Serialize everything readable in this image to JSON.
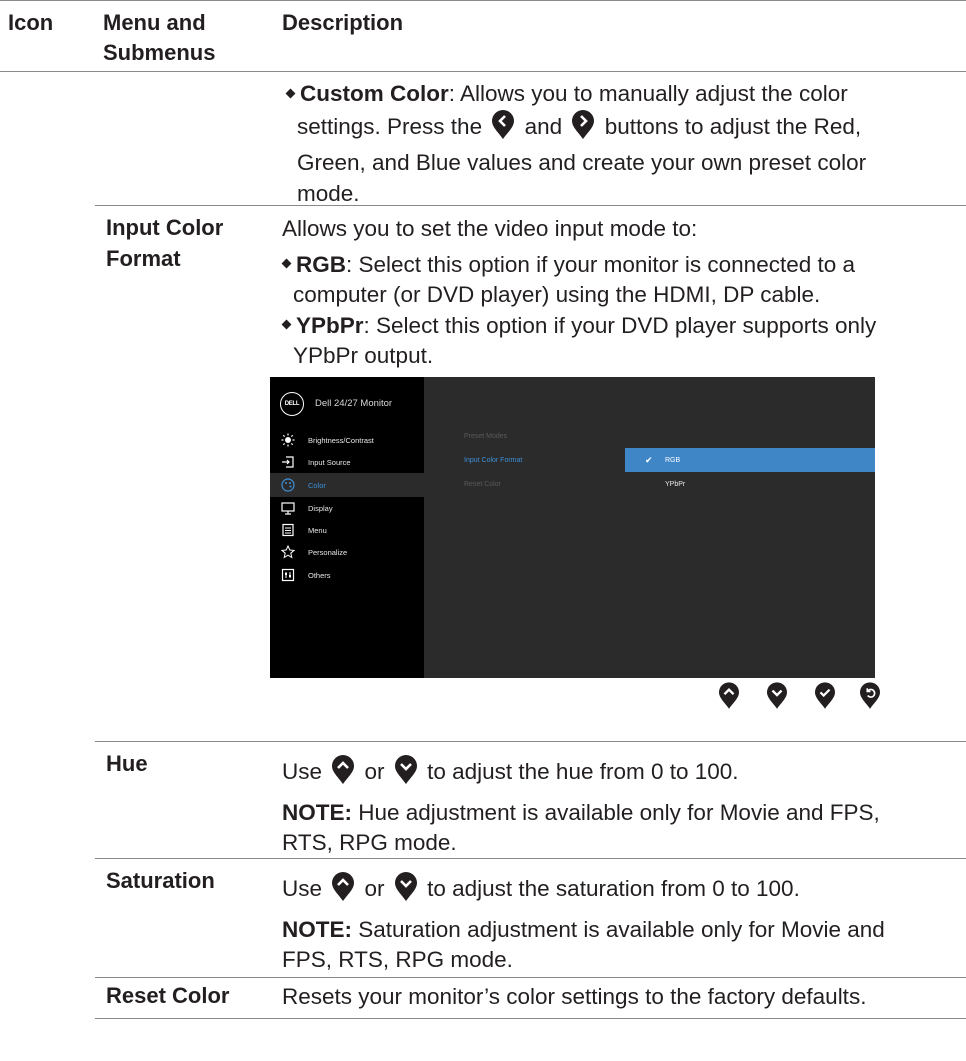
{
  "header": {
    "icon": "Icon",
    "menu": "Menu and\nSubmenus",
    "description": "Description"
  },
  "custom_color": {
    "label": "Custom Color",
    "text_1": ": Allows you to manually adjust the color",
    "text_2a": "settings. Press the",
    "text_2b": "and",
    "text_2c": "buttons to adjust the Red,",
    "text_3": "Green, and Blue values and create your own preset color",
    "text_4": "mode."
  },
  "input_color_format": {
    "label_1": "Input Color",
    "label_2": "Format",
    "intro": "Allows you to set the video input mode to:",
    "rgb_label": "RGB",
    "rgb_text_1": ": Select this option if your monitor is connected to a",
    "rgb_text_2": "computer (or DVD player) using the HDMI, DP cable.",
    "ypbpr_label": "YPbPr",
    "ypbpr_text_1": ": Select this option if your DVD player supports only",
    "ypbpr_text_2": "YPbPr output."
  },
  "osd": {
    "logo": "DELL",
    "title": "Dell 24/27 Monitor",
    "menu_items": [
      {
        "label": "Brightness/Contrast",
        "icon": "brightness-icon"
      },
      {
        "label": "Input Source",
        "icon": "input-source-icon"
      },
      {
        "label": "Color",
        "icon": "color-palette-icon"
      },
      {
        "label": "Display",
        "icon": "display-icon"
      },
      {
        "label": "Menu",
        "icon": "menu-icon"
      },
      {
        "label": "Personalize",
        "icon": "star-icon"
      },
      {
        "label": "Others",
        "icon": "others-icon"
      }
    ],
    "selected_menu": "Color",
    "submenu": [
      "Preset Modes",
      "Input Color Format",
      "Reset Color"
    ],
    "selected_submenu": "Input Color Format",
    "options": [
      "RGB",
      "YPbPr"
    ],
    "selected_option": "RGB",
    "accent_color": "#3f86c7"
  },
  "nav_buttons": [
    "up-button-icon",
    "down-button-icon",
    "check-button-icon",
    "back-button-icon"
  ],
  "hue": {
    "label": "Hue",
    "text_a": "Use",
    "text_b": "or",
    "text_c": "to adjust the hue from 0 to 100.",
    "note_label": "NOTE:",
    "note_1": " Hue adjustment is available only for Movie and FPS,",
    "note_2": "RTS, RPG mode."
  },
  "saturation": {
    "label": "Saturation",
    "text_a": "Use",
    "text_b": "or",
    "text_c": "to adjust the saturation from 0 to 100.",
    "note_label": "NOTE:",
    "note_1": " Saturation adjustment is available only for Movie and",
    "note_2": "FPS, RTS, RPG mode."
  },
  "reset_color": {
    "label": "Reset Color",
    "text": "Resets your monitor’s color settings to the factory defaults."
  }
}
